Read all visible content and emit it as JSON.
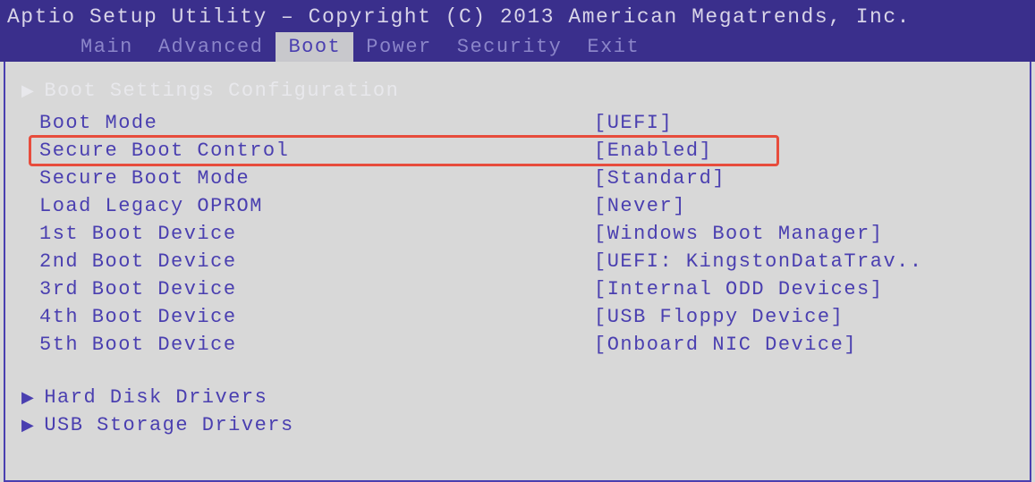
{
  "header": {
    "title": "Aptio Setup Utility – Copyright (C) 2013 American Megatrends, Inc."
  },
  "menu": {
    "items": [
      {
        "label": "Main"
      },
      {
        "label": "Advanced"
      },
      {
        "label": "Boot"
      },
      {
        "label": "Power"
      },
      {
        "label": "Security"
      },
      {
        "label": "Exit"
      }
    ],
    "active_index": 2
  },
  "section": {
    "title": "Boot Settings Configuration"
  },
  "settings": [
    {
      "label": "Boot Mode",
      "value": "[UEFI]"
    },
    {
      "label": "Secure Boot Control",
      "value": "[Enabled]",
      "highlighted": true
    },
    {
      "label": "Secure Boot Mode",
      "value": "[Standard]"
    },
    {
      "label": "Load Legacy OPROM",
      "value": "[Never]"
    },
    {
      "label": "1st Boot Device",
      "value": "[Windows Boot Manager]"
    },
    {
      "label": "2nd Boot Device",
      "value": "[UEFI: KingstonDataTrav.."
    },
    {
      "label": "3rd Boot Device",
      "value": "[Internal ODD Devices]"
    },
    {
      "label": "4th Boot Device",
      "value": "[USB Floppy Device]"
    },
    {
      "label": "5th Boot Device",
      "value": "[Onboard NIC Device]"
    }
  ],
  "submenus": [
    {
      "label": "Hard Disk Drivers"
    },
    {
      "label": "USB Storage Drivers"
    }
  ]
}
